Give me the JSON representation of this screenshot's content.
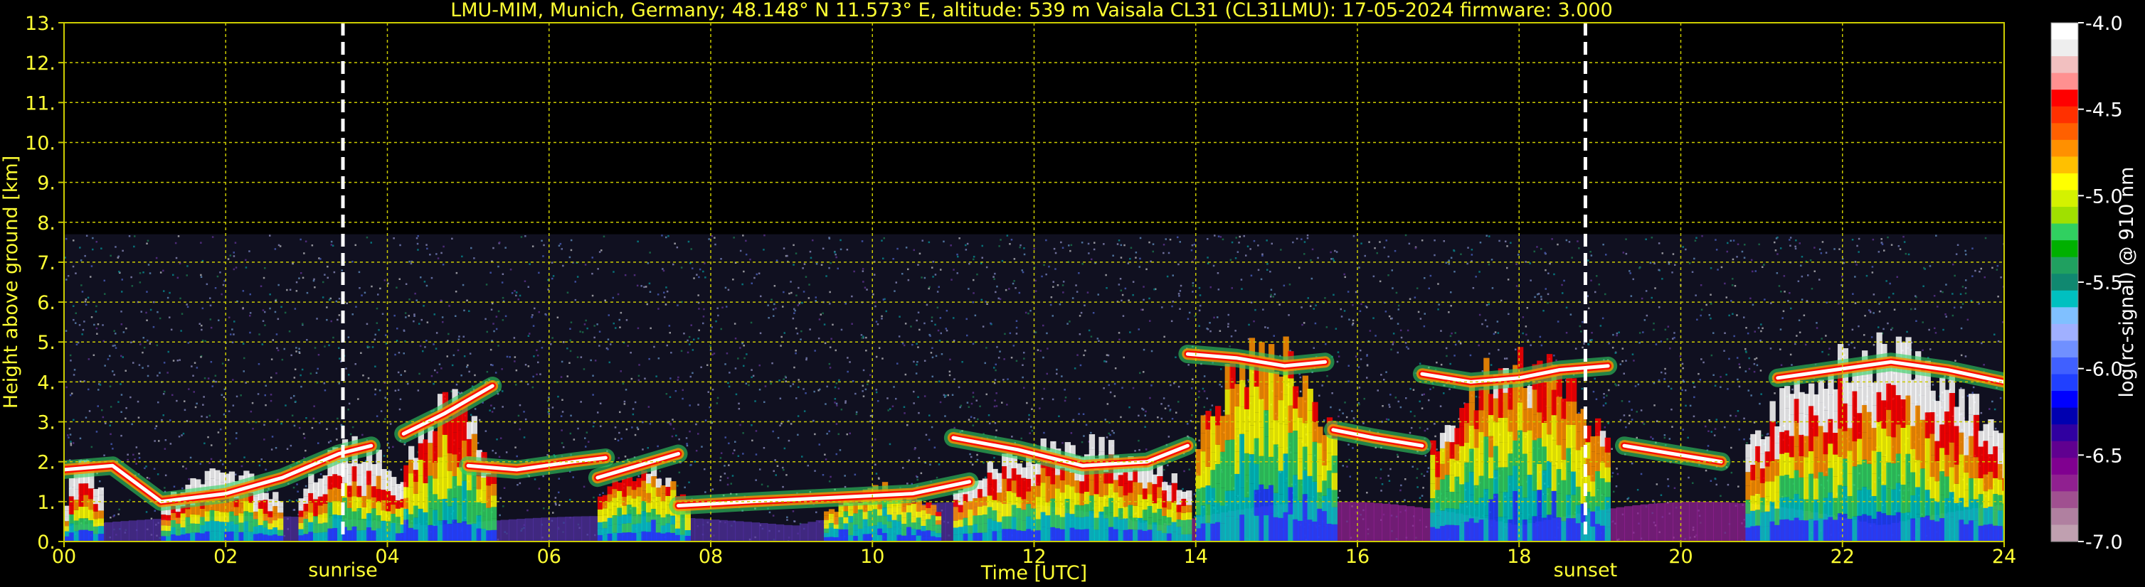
{
  "chart_data": [
    {
      "type": "heatmap",
      "title": "LMU-MIM, Munich, Germany; 48.148° N 11.573° E, altitude: 539 m    Vaisala CL31 (CL31LMU): 17-05-2024    firmware: 3.000",
      "xlabel": "Time [UTC]",
      "ylabel": "Height above ground [km]",
      "xlim": [
        0,
        24
      ],
      "ylim": [
        0,
        13
      ],
      "x_ticks": [
        0,
        2,
        4,
        6,
        8,
        10,
        12,
        14,
        16,
        18,
        20,
        22,
        24
      ],
      "x_tick_labels": [
        "00",
        "02",
        "04",
        "06",
        "08",
        "10",
        "12",
        "14",
        "16",
        "18",
        "20",
        "22",
        "24"
      ],
      "y_ticks": [
        0,
        1,
        2,
        3,
        4,
        5,
        6,
        7,
        8,
        9,
        10,
        11,
        12,
        13
      ],
      "y_tick_labels": [
        "0.",
        "1.",
        "2.",
        "3.",
        "4.",
        "5.",
        "6.",
        "7.",
        "8.",
        "9.",
        "10.",
        "11.",
        "12.",
        "13."
      ],
      "grid": true,
      "grid_color": "#cccc00",
      "signal_top_km": 7.7,
      "events": [
        {
          "label": "sunrise",
          "time": 3.45
        },
        {
          "label": "sunset",
          "time": 18.82
        }
      ],
      "layers": [
        {
          "t": [
            0.0,
            0.6,
            1.2,
            2.0,
            2.7,
            3.4,
            3.8
          ],
          "h": [
            1.8,
            1.9,
            1.0,
            1.2,
            1.6,
            2.2,
            2.4
          ]
        },
        {
          "t": [
            4.2,
            4.7,
            5.3
          ],
          "h": [
            2.7,
            3.2,
            3.9
          ]
        },
        {
          "t": [
            5.0,
            5.6,
            6.3,
            6.7
          ],
          "h": [
            1.9,
            1.8,
            2.0,
            2.1
          ]
        },
        {
          "t": [
            6.6,
            7.1,
            7.6
          ],
          "h": [
            1.6,
            1.9,
            2.2
          ]
        },
        {
          "t": [
            7.6,
            8.5,
            9.5,
            10.5,
            11.2
          ],
          "h": [
            0.9,
            1.0,
            1.1,
            1.2,
            1.5
          ]
        },
        {
          "t": [
            11.0,
            11.8,
            12.6,
            13.4,
            13.9
          ],
          "h": [
            2.6,
            2.3,
            1.9,
            2.0,
            2.4
          ]
        },
        {
          "t": [
            13.9,
            14.5,
            15.1,
            15.6
          ],
          "h": [
            4.7,
            4.6,
            4.4,
            4.5
          ]
        },
        {
          "t": [
            15.7,
            16.2,
            16.8
          ],
          "h": [
            2.8,
            2.6,
            2.4
          ]
        },
        {
          "t": [
            16.8,
            17.4,
            18.0,
            18.5,
            19.1
          ],
          "h": [
            4.2,
            4.0,
            4.1,
            4.3,
            4.4
          ]
        },
        {
          "t": [
            19.3,
            19.9,
            20.5
          ],
          "h": [
            2.4,
            2.2,
            2.0
          ]
        },
        {
          "t": [
            21.2,
            21.9,
            22.6,
            23.3,
            24.0
          ],
          "h": [
            4.1,
            4.3,
            4.5,
            4.3,
            4.0
          ]
        }
      ],
      "convective_cells": [
        {
          "t0": 0.0,
          "t1": 0.45,
          "top": 1.9,
          "peak": 1.0
        },
        {
          "t0": 1.2,
          "t1": 2.7,
          "top": 1.7,
          "peak": 0.9
        },
        {
          "t0": 2.9,
          "t1": 4.2,
          "top": 2.3,
          "peak": 0.95
        },
        {
          "t0": 4.2,
          "t1": 5.3,
          "top": 3.4,
          "peak": 0.7
        },
        {
          "t0": 6.6,
          "t1": 7.7,
          "top": 1.8,
          "peak": 0.6
        },
        {
          "t0": 9.4,
          "t1": 10.8,
          "top": 1.3,
          "peak": 0.5
        },
        {
          "t0": 11.0,
          "t1": 13.9,
          "top": 2.4,
          "peak": 0.8
        },
        {
          "t0": 14.0,
          "t1": 15.7,
          "top": 4.7,
          "peak": 0.5
        },
        {
          "t0": 16.9,
          "t1": 19.1,
          "top": 4.4,
          "peak": 0.6
        },
        {
          "t0": 20.8,
          "t1": 24.0,
          "top": 4.6,
          "peak": 0.85
        }
      ]
    },
    {
      "type": "colorbar",
      "label": "log(rc-signal) @ 910 nm",
      "range": [
        -7.0,
        -4.0
      ],
      "tick_values": [
        -4.0,
        -4.5,
        -5.0,
        -5.5,
        -6.0,
        -6.5,
        -7.0
      ],
      "tick_labels": [
        "-4.0",
        "-4.5",
        "-5.0",
        "-5.5",
        "-6.0",
        "-6.5",
        "-7.0"
      ],
      "colors": [
        "#ffffff",
        "#eeeeee",
        "#f2c0c0",
        "#ff9090",
        "#ff0000",
        "#ff3000",
        "#ff6000",
        "#ff9000",
        "#ffc000",
        "#ffff00",
        "#d4f200",
        "#a0e000",
        "#30d060",
        "#00b000",
        "#20a060",
        "#108870",
        "#00c0c0",
        "#80c0ff",
        "#a0b0ff",
        "#7090ff",
        "#4060ff",
        "#2040ff",
        "#0000ff",
        "#0000b0",
        "#3000a0",
        "#600090",
        "#800090",
        "#902090",
        "#a05090",
        "#b080a0",
        "#c0a0b0"
      ]
    }
  ]
}
